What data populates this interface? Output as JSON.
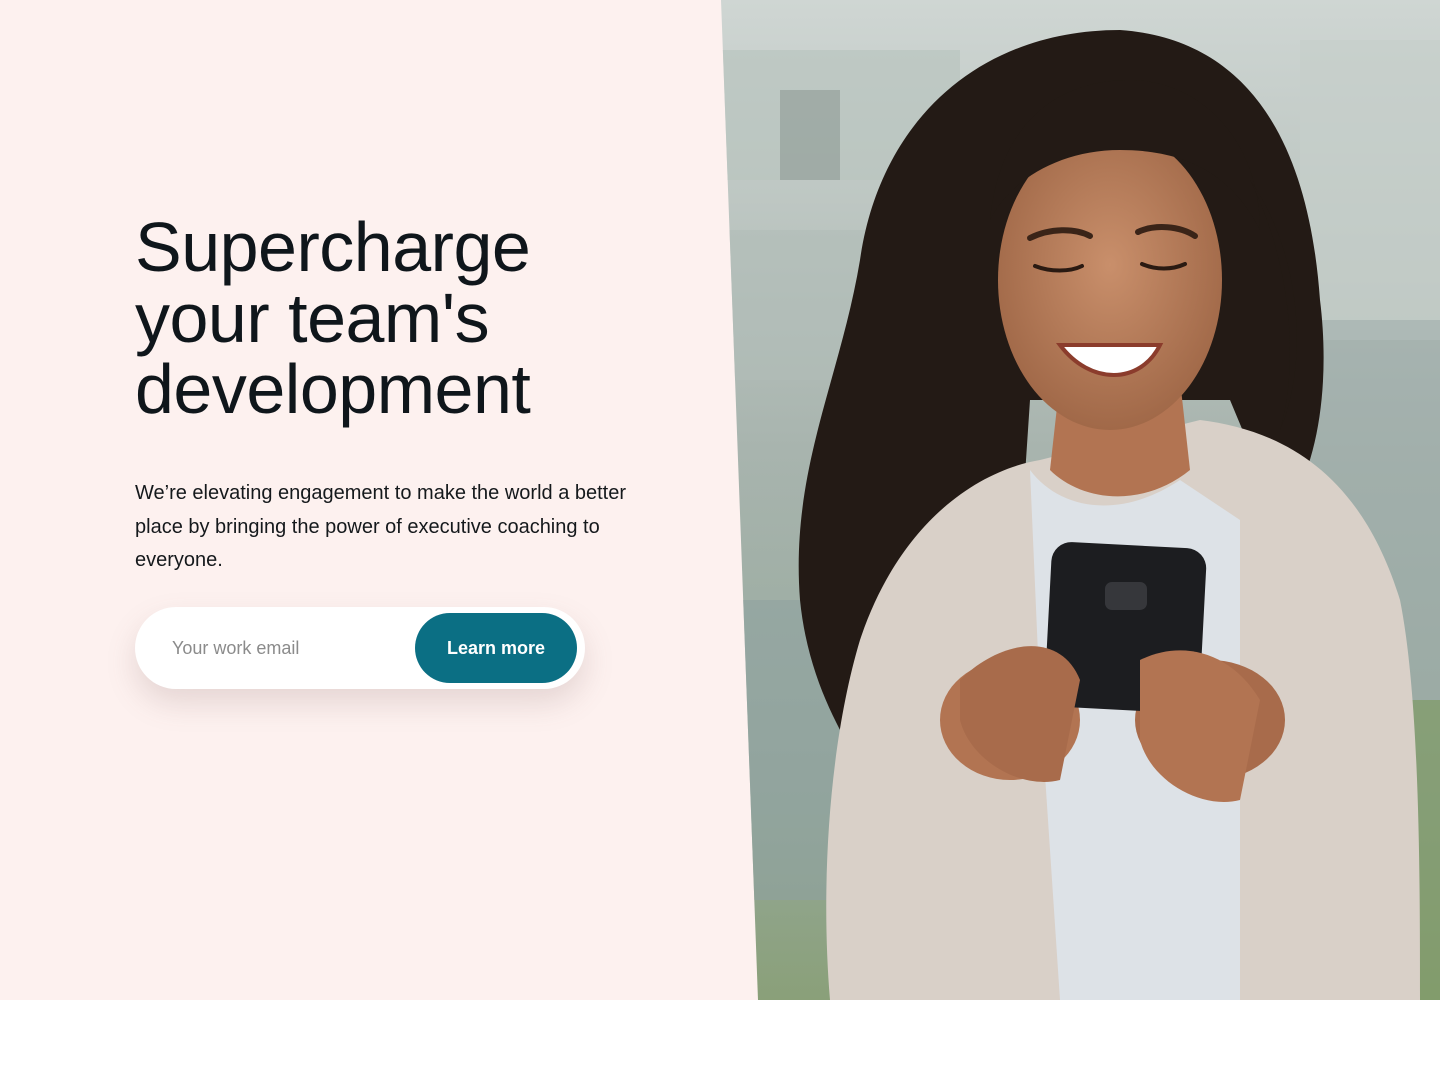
{
  "hero": {
    "headline_lines": [
      "Supercharge",
      "your team's",
      "development"
    ],
    "subtext": "We’re elevating engagement to make the world a better place by bringing the power of executive coaching to everyone."
  },
  "signup": {
    "email_placeholder": "Your work email",
    "email_value": "",
    "cta_label": "Learn more"
  },
  "colors": {
    "hero_background": "#fdf1ef",
    "cta_background": "#0b6f84",
    "headline_text": "#0f161b"
  },
  "photo": {
    "subject": "woman-smiling-at-phone"
  }
}
